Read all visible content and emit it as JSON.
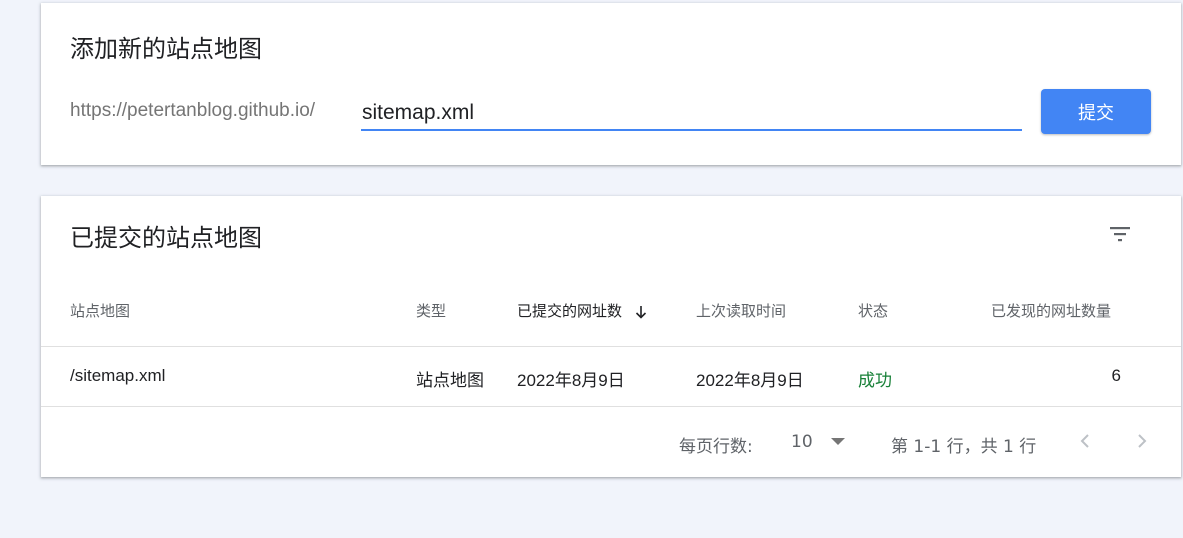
{
  "add_sitemap": {
    "title": "添加新的站点地图",
    "url_prefix": "https://petertanblog.github.io/",
    "input_value": "sitemap.xml",
    "submit_label": "提交"
  },
  "submitted": {
    "title": "已提交的站点地图",
    "filter_icon": "filter-icon",
    "columns": [
      "站点地图",
      "类型",
      "已提交的网址数",
      "上次读取时间",
      "状态",
      "已发现的网址数量"
    ],
    "sorted_column": "已提交的网址数",
    "sort_direction": "descending",
    "rows": [
      {
        "sitemap": "/sitemap.xml",
        "type": "站点地图",
        "submitted": "2022年8月9日",
        "last_read": "2022年8月9日",
        "status": "成功",
        "discovered": "6"
      }
    ],
    "pagination": {
      "rows_per_page_label": "每页行数:",
      "rows_per_page": "10",
      "range_text": "第 1-1 行，共 1 行"
    }
  },
  "colors": {
    "accent": "#4285f4",
    "success": "#188038",
    "background": "#f1f4fb"
  }
}
